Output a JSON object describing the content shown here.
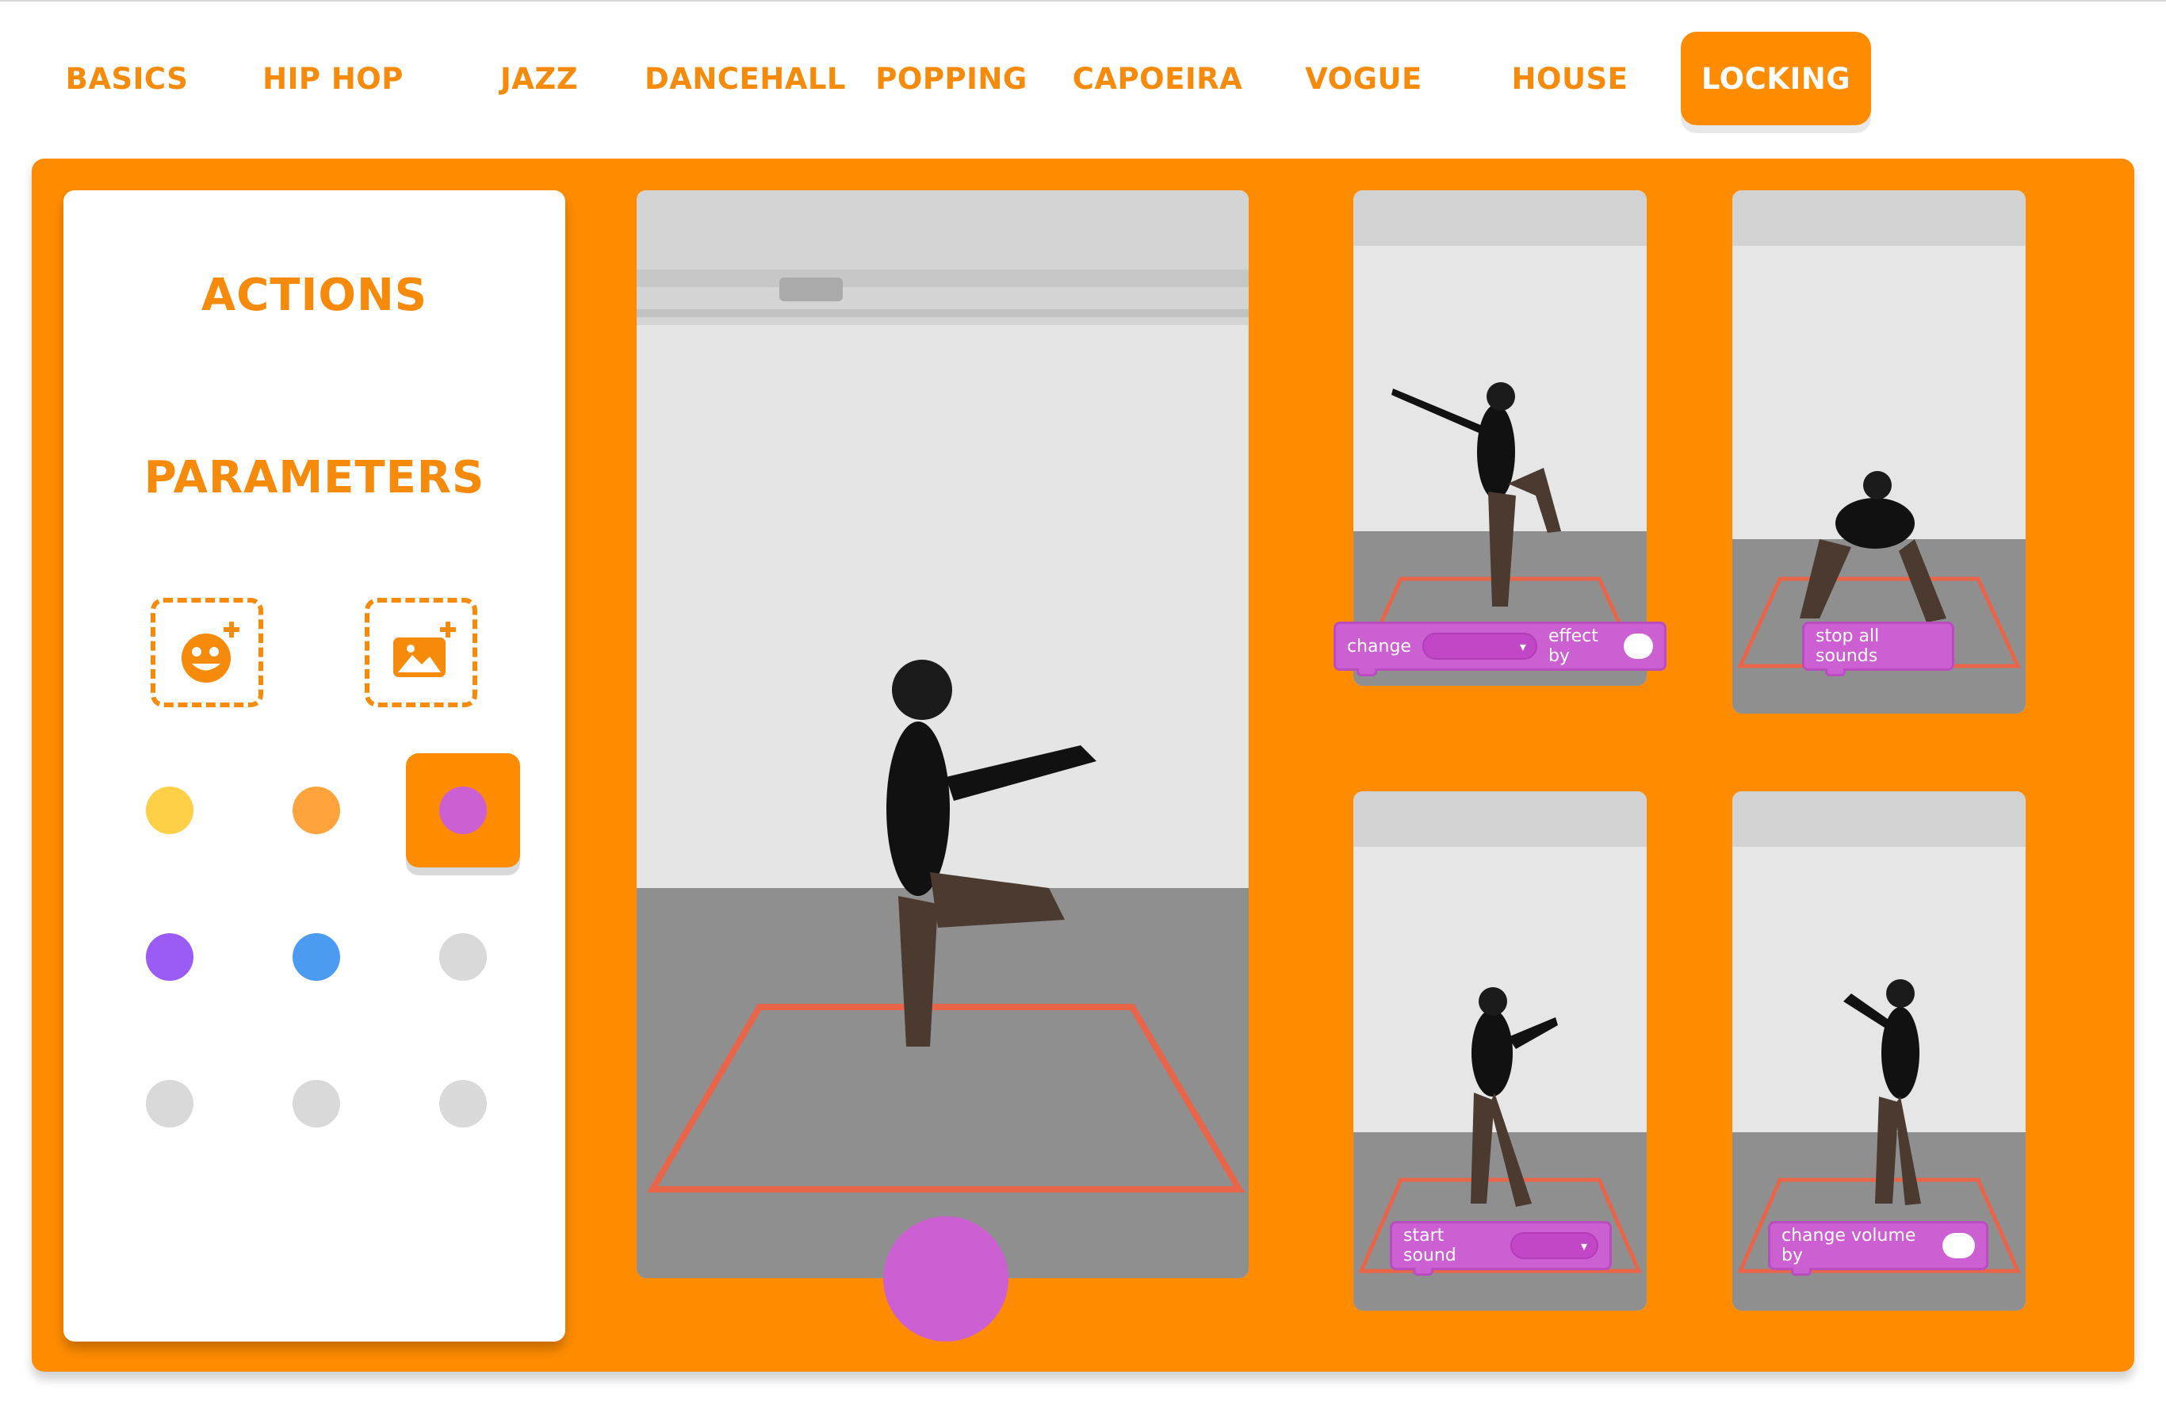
{
  "tabs": [
    {
      "label": "BASICS",
      "active": false
    },
    {
      "label": "HIP HOP",
      "active": false
    },
    {
      "label": "JAZZ",
      "active": false
    },
    {
      "label": "DANCEHALL",
      "active": false
    },
    {
      "label": "POPPING",
      "active": false
    },
    {
      "label": "CAPOEIRA",
      "active": false
    },
    {
      "label": "VOGUE",
      "active": false
    },
    {
      "label": "HOUSE",
      "active": false
    },
    {
      "label": "LOCKING",
      "active": true
    }
  ],
  "sidebar": {
    "actions_title": "ACTIONS",
    "parameters_title": "PARAMETERS",
    "add_sprite_icon": "add-sprite-icon",
    "add_backdrop_icon": "add-backdrop-icon",
    "colors": [
      "#ffcf47",
      "#ffa33c",
      "#cc5fd1",
      "#9b5cf6",
      "#4b9bf2",
      "#d9d9d9",
      "#d9d9d9",
      "#d9d9d9",
      "#d9d9d9"
    ],
    "selected_color_index": 2
  },
  "blocks": {
    "effect": {
      "prefix": "change",
      "suffix": "effect by",
      "dropdown_glyph": "▾"
    },
    "stop": {
      "label": "stop all sounds"
    },
    "sound": {
      "label": "start sound",
      "dropdown_glyph": "▾"
    },
    "volume": {
      "label": "change volume by"
    }
  },
  "colors": {
    "accent": "#ff8c00",
    "tab_text": "#f58a0b",
    "block": "#cc5fd1",
    "tape": "#e8654a"
  }
}
